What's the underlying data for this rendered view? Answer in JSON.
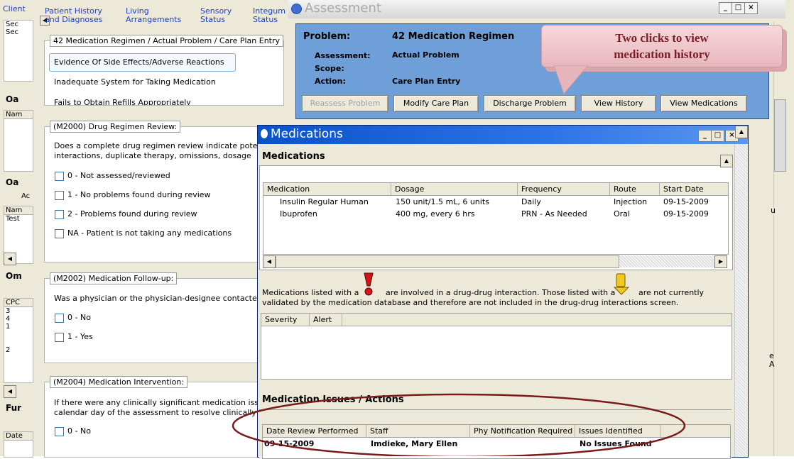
{
  "left_strip": {
    "client_label": "Client",
    "sec1": "Sec",
    "sec2": "Sec",
    "oa1": "Oa",
    "nam1": "Nam",
    "oa2": "Oa",
    "ac": "Ac",
    "nam2": "Nam",
    "test": "Test",
    "om": "Om",
    "cpc": "CPC",
    "nums": [
      "3",
      "4",
      "1",
      "2"
    ],
    "fur": "Fur",
    "date": "Date"
  },
  "oasis_tabs": [
    {
      "line1": "Patient History",
      "line2": "and Diagnoses"
    },
    {
      "line1": "Living",
      "line2": "Arrangements"
    },
    {
      "line1": "Sensory",
      "line2": "Status"
    },
    {
      "line1": "Integum",
      "line2": "Status"
    }
  ],
  "care_plan_entry": {
    "legend": "42 Medication Regimen / Actual Problem / Care Plan Entry",
    "items": [
      "Evidence Of Side Effects/Adverse Reactions",
      "Inadequate System for Taking Medication",
      "Fails to Obtain Refills Appropriately"
    ]
  },
  "m2000": {
    "legend": "(M2000) Drug Regimen Review:",
    "question_l1": "Does a complete drug regimen review indicate pote",
    "question_l2": "interactions, duplicate therapy, omissions, dosage",
    "options": [
      "0 - Not assessed/reviewed",
      "1 - No problems found during review",
      "2 - Problems found during review",
      "NA - Patient is not taking any medications"
    ]
  },
  "m2002": {
    "legend": "(M2002) Medication Follow-up:",
    "question": "Was a physician or the physician-designee contacte",
    "options": [
      "0 - No",
      "1 - Yes"
    ]
  },
  "m2004": {
    "legend": "(M2004) Medication Intervention:",
    "question_l1": "If there were any clinically significant medication iss",
    "question_l2": "calendar day of the assessment to resolve clinically",
    "options": [
      "0 - No"
    ]
  },
  "assessment_window": {
    "title": "Assessment",
    "problem_label": "Problem:",
    "problem_value": "42 Medication Regimen",
    "assessment_label": "Assessment:",
    "assessment_value": "Actual Problem",
    "scope_label": "Scope:",
    "action_label": "Action:",
    "action_value": "Care Plan Entry",
    "buttons": {
      "reassess": "Reassess Problem",
      "modify": "Modify Care Plan",
      "discharge": "Discharge Problem",
      "history": "View History",
      "medications": "View Medications"
    },
    "right_edge_u": "u",
    "right_edge_e": "e",
    "right_edge_a": "A"
  },
  "callout": {
    "line1": "Two clicks to view",
    "line2": "medication history"
  },
  "medications_window": {
    "title": "Medications",
    "section_title": "Medications",
    "columns": [
      "Medication",
      "Dosage",
      "Frequency",
      "Route",
      "Start Date"
    ],
    "rows": [
      {
        "medication": "Insulin Regular Human",
        "dosage": "150 unit/1.5 mL, 6 units",
        "frequency": "Daily",
        "route": "Injection",
        "start": "09-15-2009"
      },
      {
        "medication": "Ibuprofen",
        "dosage": "400 mg, every 6 hrs",
        "frequency": "PRN - As Needed",
        "route": "Oral",
        "start": "09-15-2009"
      }
    ],
    "legend_text_1": "Medications listed with a",
    "legend_text_2": "are involved in a drug-drug interaction.  Those listed with a",
    "legend_text_3": "are not currently",
    "legend_text_4": "validated by the medication database and therefore are not included in the drug-drug interactions screen.",
    "alert_columns": [
      "Severity",
      "Alert"
    ],
    "issues_title": "Medication Issues / Actions",
    "issue_columns": [
      "Date Review Performed",
      "Staff",
      "Phy Notification Required",
      "Issues Identified"
    ],
    "issue_rows": [
      {
        "date": "09-15-2009",
        "staff": "Imdieke, Mary Ellen",
        "phy": "",
        "issues": "No Issues Found"
      }
    ]
  },
  "colors": {
    "accent_blue": "#3a6fc4",
    "assessment_panel": "#6e9fd8",
    "callout_pink": "#f1c7cc",
    "callout_text": "#7a1e2a",
    "oval_red": "#7a1a1a"
  }
}
